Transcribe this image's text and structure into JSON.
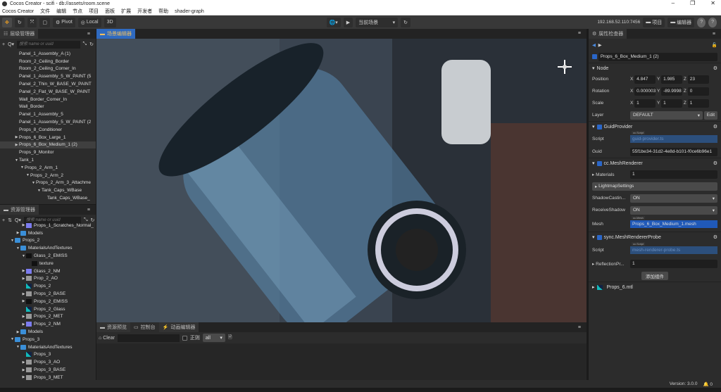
{
  "window": {
    "title": "Cocos Creator - scifi - db://assets/room.scene",
    "controls": [
      "–",
      "❐",
      "✕"
    ]
  },
  "menu": [
    "Cocos Creator",
    "文件",
    "编辑",
    "节点",
    "项目",
    "面板",
    "扩展",
    "开发者",
    "帮助",
    "shader-graph"
  ],
  "toolbar": {
    "pivot": "Pivot",
    "local": "Local",
    "mode3d": "3D",
    "scene_select": "当前场景",
    "ip": "192.168.52.110:7456",
    "project": "项目",
    "editor": "编辑器",
    "help": "?"
  },
  "hierarchy": {
    "title": "层级管理器",
    "search_placeholder": "搜索 name or uuid",
    "items": [
      {
        "label": "Panel_1_Assembly_A (1)",
        "depth": 0,
        "arrow": ""
      },
      {
        "label": "Room_2_Ceiling_Border",
        "depth": 0,
        "arrow": ""
      },
      {
        "label": "Room_2_Ceiling_Corner_In",
        "depth": 0,
        "arrow": ""
      },
      {
        "label": "Panel_1_Assembly_5_W_PAINT (5",
        "depth": 0,
        "arrow": ""
      },
      {
        "label": "Panel_2_Thin_W_BASE_W_PAINT",
        "depth": 0,
        "arrow": ""
      },
      {
        "label": "Panel_2_Flat_W_BASE_W_PAINT",
        "depth": 0,
        "arrow": ""
      },
      {
        "label": "Wall_Border_Corner_In",
        "depth": 0,
        "arrow": ""
      },
      {
        "label": "Wall_Border",
        "depth": 0,
        "arrow": ""
      },
      {
        "label": "Panel_1_Assembly_5",
        "depth": 0,
        "arrow": ""
      },
      {
        "label": "Panel_1_Assembly_5_W_PAINT (2",
        "depth": 0,
        "arrow": ""
      },
      {
        "label": "Props_8_Conditioner",
        "depth": 0,
        "arrow": ""
      },
      {
        "label": "Props_6_Box_Large_1",
        "depth": 0,
        "arrow": "▶"
      },
      {
        "label": "Props_6_Box_Medium_1 (2)",
        "depth": 0,
        "arrow": "▶",
        "selected": true
      },
      {
        "label": "Props_9_Monitor",
        "depth": 0,
        "arrow": ""
      },
      {
        "label": "Tank_1",
        "depth": 0,
        "arrow": "▼"
      },
      {
        "label": "Props_2_Arm_1",
        "depth": 1,
        "arrow": "▼"
      },
      {
        "label": "Props_2_Arm_2",
        "depth": 2,
        "arrow": "▼"
      },
      {
        "label": "Props_2_Arm_3_Attachme",
        "depth": 3,
        "arrow": "▼"
      },
      {
        "label": "Tank_Caps_WBase",
        "depth": 4,
        "arrow": "▼"
      },
      {
        "label": "Tank_Caps_WBase_",
        "depth": 5,
        "arrow": ""
      }
    ]
  },
  "assets": {
    "title": "资源管理器",
    "search_placeholder": "搜索 name or uuid",
    "items": [
      {
        "label": "Props_1_Scratches_Normal_",
        "depth": 2,
        "arrow": "▶",
        "icon": "img"
      },
      {
        "label": "Models",
        "depth": 1,
        "arrow": "▶",
        "icon": "folder"
      },
      {
        "label": "Props_2",
        "depth": 0,
        "arrow": "▼",
        "icon": "folder"
      },
      {
        "label": "MaterialsAndTextures",
        "depth": 1,
        "arrow": "▼",
        "icon": "folder"
      },
      {
        "label": "Glass_2_EMISS",
        "depth": 2,
        "arrow": "▼",
        "icon": "dark"
      },
      {
        "label": "texture",
        "depth": 3,
        "arrow": "",
        "icon": "dark"
      },
      {
        "label": "Glass_2_NM",
        "depth": 2,
        "arrow": "▶",
        "icon": "img"
      },
      {
        "label": "Prop_2_AO",
        "depth": 2,
        "arrow": "▶",
        "icon": "gray"
      },
      {
        "label": "Props_2",
        "depth": 2,
        "arrow": "",
        "icon": "mtl"
      },
      {
        "label": "Props_2_BASE",
        "depth": 2,
        "arrow": "▶",
        "icon": "gray"
      },
      {
        "label": "Props_2_EMISS",
        "depth": 2,
        "arrow": "▶",
        "icon": "dark"
      },
      {
        "label": "Props_2_Glass",
        "depth": 2,
        "arrow": "",
        "icon": "mtl"
      },
      {
        "label": "Props_2_MET",
        "depth": 2,
        "arrow": "▶",
        "icon": "gray"
      },
      {
        "label": "Props_2_NM",
        "depth": 2,
        "arrow": "▶",
        "icon": "img"
      },
      {
        "label": "Models",
        "depth": 1,
        "arrow": "▶",
        "icon": "folder"
      },
      {
        "label": "Props_3",
        "depth": 0,
        "arrow": "▼",
        "icon": "folder"
      },
      {
        "label": "MaterialsAndTextures",
        "depth": 1,
        "arrow": "▼",
        "icon": "folder"
      },
      {
        "label": "Props_3",
        "depth": 2,
        "arrow": "",
        "icon": "mtl"
      },
      {
        "label": "Props_3_AO",
        "depth": 2,
        "arrow": "▶",
        "icon": "gray"
      },
      {
        "label": "Props_3_BASE",
        "depth": 2,
        "arrow": "▶",
        "icon": "gray"
      },
      {
        "label": "Props_3_MET",
        "depth": 2,
        "arrow": "▶",
        "icon": "gray"
      }
    ]
  },
  "scene": {
    "tab": "场景编辑器"
  },
  "console": {
    "tabs": [
      "资源预览",
      "控制台",
      "动画编辑器"
    ],
    "clear": "Clear",
    "regex": "正则",
    "level": "all"
  },
  "inspector": {
    "title": "属性检查器",
    "node_name": "Props_6_Box_Medium_1 (2)",
    "node": {
      "title": "Node",
      "position": {
        "label": "Position",
        "x": "4.847",
        "y": "1.985",
        "z": "23"
      },
      "rotation": {
        "label": "Rotation",
        "x": "0.000003",
        "y": "-89.9998",
        "z": "0"
      },
      "scale": {
        "label": "Scale",
        "x": "1",
        "y": "1",
        "z": "1"
      },
      "layer": {
        "label": "Layer",
        "value": "DEFAULT",
        "edit": "Edit"
      }
    },
    "guid_provider": {
      "title": "GuidProvider",
      "script_label": "Script",
      "script_type": "cc.Script",
      "script": "guid-provider.ts",
      "guid_label": "Guid",
      "guid": "55f1be34-31d2-4e8d-b101-f0ce6b96e1"
    },
    "mesh_renderer": {
      "title": "cc.MeshRenderer",
      "materials_label": "Materials",
      "materials": "1",
      "lightmap": "LightmapSettings",
      "shadow_label": "ShadowCastin...",
      "shadow": "ON",
      "receive_label": "ReceiveShadow",
      "receive": "ON",
      "mesh_label": "Mesh",
      "mesh_type": "cc.Mesh",
      "mesh": "Props_6_Box_Medium_1.mesh"
    },
    "probe": {
      "title": "sync.MeshRendererProbe",
      "script_label": "Script",
      "script_type": "cc.Script",
      "script": "mesh-renderer-probe.ts",
      "reflection_label": "ReflectionPr...",
      "reflection": "1"
    },
    "add_component": "添加组件",
    "material": "Props_6.mtl"
  },
  "status": {
    "version": "Version: 3.0.0",
    "notifications": "0"
  }
}
